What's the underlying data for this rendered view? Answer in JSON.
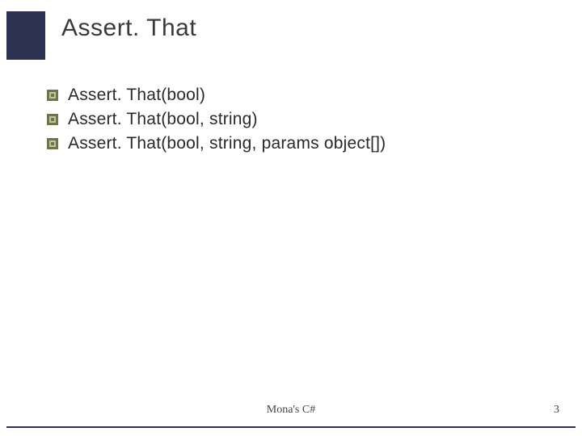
{
  "title": "Assert. That",
  "items": [
    "Assert. That(bool)",
    "Assert. That(bool, string)",
    "Assert. That(bool, string, params object[])"
  ],
  "footer": "Mona's C#",
  "page": "3",
  "colors": {
    "accent": "#2c3250",
    "bullet_outer": "#6b764d",
    "bullet_inner": "#bfc79a"
  }
}
